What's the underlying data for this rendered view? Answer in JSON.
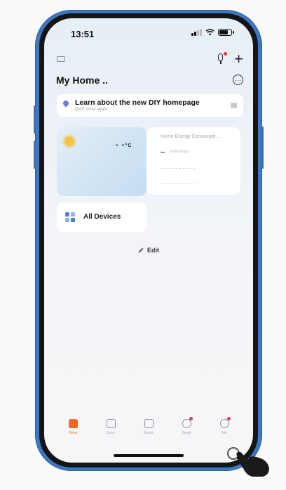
{
  "status_bar": {
    "time": "13:51"
  },
  "header": {
    "home_title": "My Home .."
  },
  "banner": {
    "title": "Learn about the new DIY homepage",
    "subtitle": "Don't show again"
  },
  "weather": {
    "temp_value": "- -",
    "temp_unit": "°C"
  },
  "energy": {
    "title": "Home Energy Consumpti...",
    "value": "--",
    "unit": "kWh/Today"
  },
  "devices": {
    "label": "All Devices"
  },
  "edit": {
    "label": "Edit"
  },
  "tabs": [
    {
      "label": "Home"
    },
    {
      "label": "Scen"
    },
    {
      "label": "Scene"
    },
    {
      "label": "Smart"
    },
    {
      "label": "Me"
    }
  ],
  "colors": {
    "accent": "#f26a21",
    "frame": "#3d78c4",
    "badge": "#e23b3b"
  }
}
